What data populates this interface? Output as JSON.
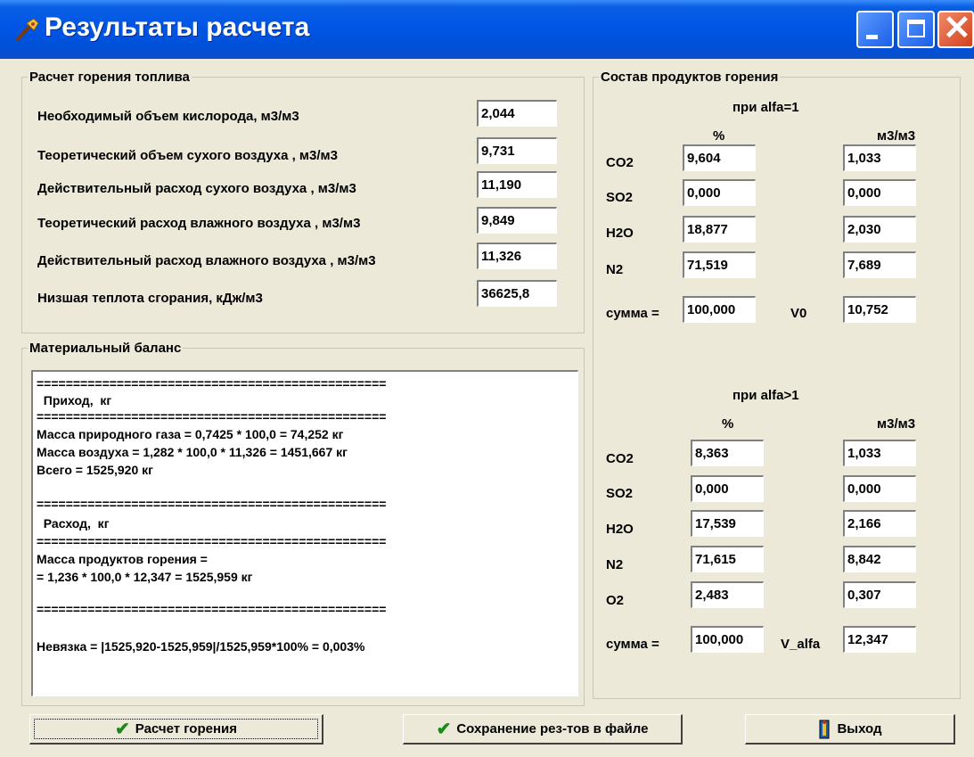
{
  "window": {
    "title": "Результаты расчета",
    "icon": "wrench-icon"
  },
  "fuel": {
    "legend": "Расчет горения топлива",
    "rows": [
      {
        "label": "Необходимый объем кислорода, м3/м3",
        "value": "2,044"
      },
      {
        "label": "Теоретический объем сухого воздуха , м3/м3",
        "value": "9,731"
      },
      {
        "label": "Действительный расход сухого воздуха , м3/м3",
        "value": "11,190"
      },
      {
        "label": "Теоретический расход влажного воздуха , м3/м3",
        "value": "9,849"
      },
      {
        "label": "Действительный расход влажного воздуха , м3/м3",
        "value": "11,326"
      },
      {
        "label": "Низшая теплота сгорания, кДж/м3",
        "value": "36625,8"
      }
    ]
  },
  "balance": {
    "legend": "Материальный баланс",
    "lines": [
      "================================================",
      "  Приход,  кг",
      "================================================",
      "Масса природного газа = 0,7425 * 100,0 = 74,252 кг",
      "Масса воздуха = 1,282 * 100,0 * 11,326 = 1451,667 кг",
      "Всего = 1525,920 кг",
      "",
      "================================================",
      "  Расход,  кг",
      "================================================",
      "Масса продуктов горения =",
      "= 1,236 * 100,0 * 12,347 = 1525,959 кг",
      "",
      "================================================",
      "",
      "Невязка = |1525,920-1525,959|/1525,959*100% = 0,003%"
    ]
  },
  "products": {
    "legend": "Состав продуктов горения",
    "alfa1": {
      "title": "при alfa=1",
      "col_pct": "%",
      "col_m3": "м3/м3",
      "rows": [
        {
          "label": "CO2",
          "pct": "9,604",
          "m3": "1,033"
        },
        {
          "label": "SO2",
          "pct": "0,000",
          "m3": "0,000"
        },
        {
          "label": "H2O",
          "pct": "18,877",
          "m3": "2,030"
        },
        {
          "label": "N2",
          "pct": "71,519",
          "m3": "7,689"
        }
      ],
      "sum_label": "сумма =",
      "sum_value": "100,000",
      "v_label": "V0",
      "v_value": "10,752"
    },
    "alfa2": {
      "title": "при alfa>1",
      "col_pct": "%",
      "col_m3": "м3/м3",
      "rows": [
        {
          "label": "CO2",
          "pct": "8,363",
          "m3": "1,033"
        },
        {
          "label": "SO2",
          "pct": "0,000",
          "m3": "0,000"
        },
        {
          "label": "H2O",
          "pct": "17,539",
          "m3": "2,166"
        },
        {
          "label": "N2",
          "pct": "71,615",
          "m3": "8,842"
        },
        {
          "label": "O2",
          "pct": "2,483",
          "m3": "0,307"
        }
      ],
      "sum_label": "сумма =",
      "sum_value": "100,000",
      "v_label": "V_alfa",
      "v_value": "12,347"
    }
  },
  "buttons": {
    "calc": "Расчет горения",
    "save": "Сохранение рез-тов в файле",
    "exit": "Выход"
  },
  "icons": {
    "calc": "checkmark-icon",
    "save": "checkmark-icon",
    "exit": "door-exit-icon"
  }
}
